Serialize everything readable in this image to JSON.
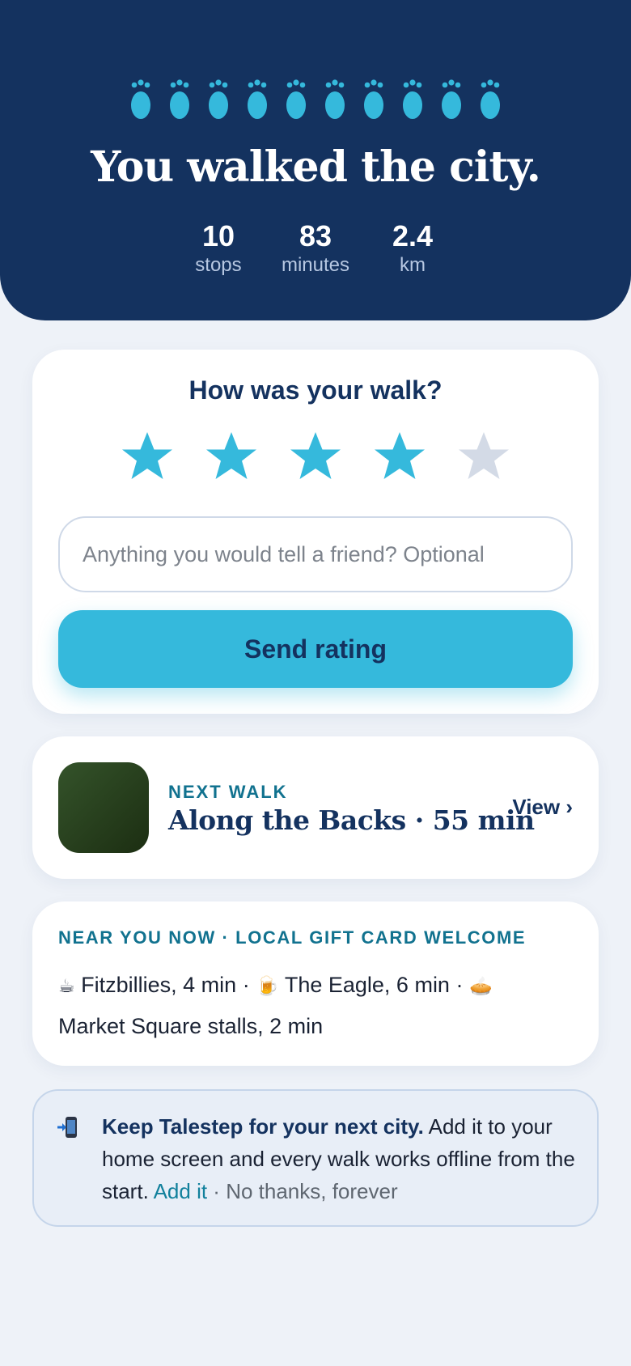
{
  "hero": {
    "footprint_count": 10,
    "icon": "footprint-icon",
    "title": "You walked the city.",
    "stats": [
      {
        "value": "10",
        "label": "stops"
      },
      {
        "value": "83",
        "label": "minutes"
      },
      {
        "value": "2.4",
        "label": "km"
      }
    ]
  },
  "rating": {
    "question": "How was your walk?",
    "stars_total": 5,
    "stars_selected": 4,
    "comment_placeholder": "Anything you would tell a friend? Optional",
    "comment_value": "",
    "submit_label": "Send rating"
  },
  "next_walk": {
    "kicker": "NEXT WALK",
    "title": "Along the Backs · 55 min",
    "link": "View ›"
  },
  "near_you": {
    "kicker": "NEAR YOU NOW · LOCAL GIFT CARD WELCOME",
    "places": [
      {
        "icon": "☕",
        "icon_name": "coffee-icon",
        "text": "Fitzbillies, 4 min"
      },
      {
        "icon": "🍺",
        "icon_name": "beer-icon",
        "text": "The Eagle, 6 min"
      },
      {
        "icon": "🥧",
        "icon_name": "pie-icon",
        "text": "Market Square stalls, 2 min"
      }
    ],
    "separator": " · "
  },
  "install": {
    "icon": "phone-install-icon",
    "headline": "Keep Talestep for your next city.",
    "body": " Add it to your home screen and every walk works offline from the start. ",
    "add_link": "Add it",
    "separator": " · ",
    "dismiss_link": "No thanks, forever"
  },
  "colors": {
    "hero_bg": "#14325f",
    "accent": "#35b9dc",
    "star_empty": "#d3dae6",
    "kicker": "#11728f",
    "page_bg": "#eef2f8"
  }
}
